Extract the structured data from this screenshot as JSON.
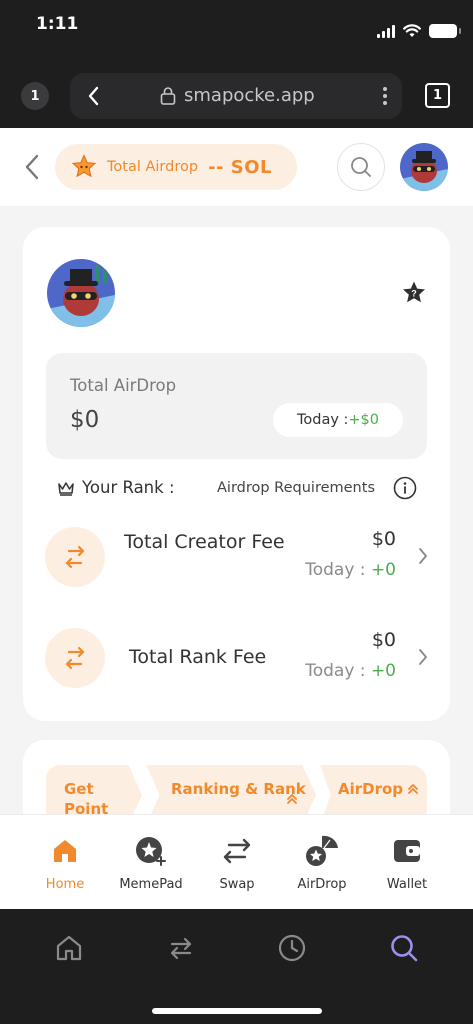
{
  "status_bar": {
    "time": "1:11"
  },
  "browser": {
    "tab_count_left": "1",
    "url": "smapocke.app",
    "tab_count_right": "1"
  },
  "header": {
    "pill_label": "Total Airdrop",
    "pill_value": "-- SOL"
  },
  "summary": {
    "total_label": "Total AirDrop",
    "total_value": "$0",
    "today_prefix": "Today : ",
    "today_value": "+$0"
  },
  "rank": {
    "label": "Your Rank :",
    "requirements": "Airdrop Requirements"
  },
  "fees": [
    {
      "title": "Total Creator Fee",
      "amount": "$0",
      "today_prefix": "Today : ",
      "today_value": "+0"
    },
    {
      "title": "Total Rank Fee",
      "amount": "$0",
      "today_prefix": "Today : ",
      "today_value": "+0"
    }
  ],
  "chips": [
    {
      "label": "Get Point"
    },
    {
      "label": "Ranking & Rank"
    },
    {
      "label": "AirDrop"
    }
  ],
  "nav": [
    {
      "label": "Home",
      "icon": "home-icon",
      "active": true
    },
    {
      "label": "MemePad",
      "icon": "memepad-icon"
    },
    {
      "label": "Swap",
      "icon": "swap-icon"
    },
    {
      "label": "AirDrop",
      "icon": "airdrop-icon"
    },
    {
      "label": "Wallet",
      "icon": "wallet-icon"
    }
  ],
  "colors": {
    "accent": "#f08a2c",
    "accent_soft": "#fdeee2",
    "positive": "#4bb04b",
    "browser_active": "#9b8ff0"
  }
}
